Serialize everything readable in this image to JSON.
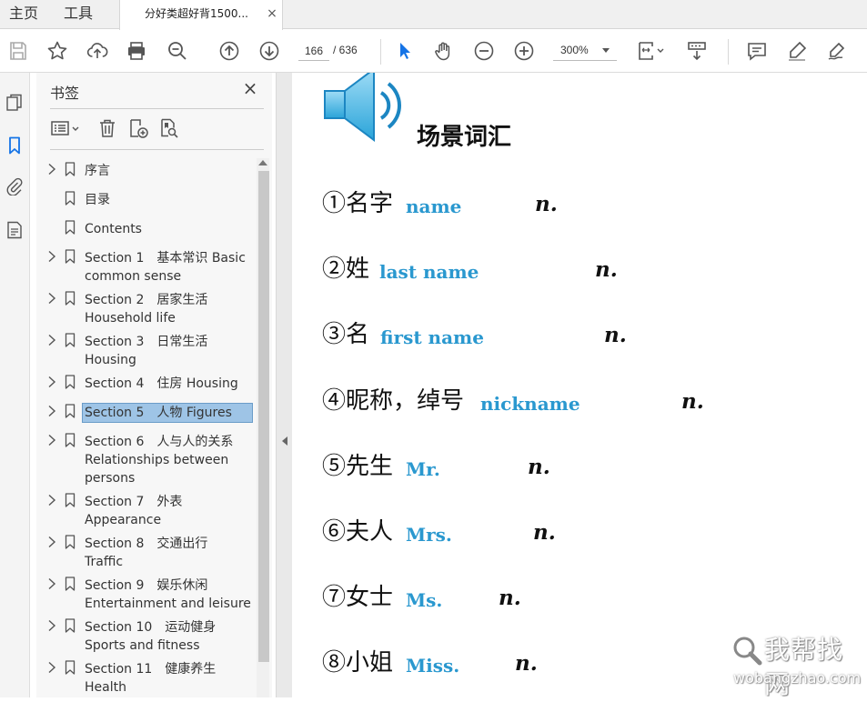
{
  "tabs": {
    "home": "主页",
    "tools": "工具",
    "document": "分好类超好背1500...",
    "close_symbol": "×"
  },
  "toolbar": {
    "page_current": "166",
    "page_total": "/ 636",
    "zoom": "300%",
    "icons": [
      "save-icon",
      "star-icon",
      "upload-icon",
      "print-icon",
      "zoom-search-icon",
      "page-up-icon",
      "page-down-icon",
      "select-cursor-icon",
      "hand-icon",
      "zoom-out-icon",
      "zoom-in-icon",
      "fit-page-icon",
      "scroll-mode-icon",
      "comment-icon",
      "highlight-icon",
      "sign-icon"
    ]
  },
  "rail": {
    "icons": [
      "page-thumbnails-icon",
      "bookmarks-icon",
      "attachments-icon",
      "document-properties-icon"
    ],
    "active": "bookmarks-icon"
  },
  "bookmarks_panel": {
    "title": "书签",
    "close_symbol": "×",
    "tools": [
      "options-menu-icon",
      "delete-bookmark-icon",
      "new-bookmark-icon",
      "bookmark-search-icon"
    ],
    "items": [
      {
        "label": "序言",
        "expandable": true
      },
      {
        "label": "目录",
        "expandable": false
      },
      {
        "label": "Contents",
        "expandable": false
      },
      {
        "label": "Section 1　基本常识 Basic\ncommon sense",
        "expandable": true
      },
      {
        "label": "Section 2　居家生活\nHousehold life",
        "expandable": true
      },
      {
        "label": "Section 3　日常生活\nHousing",
        "expandable": true
      },
      {
        "label": "Section 4　住房 Housing",
        "expandable": true
      },
      {
        "label": "Section 5　人物 Figures",
        "expandable": true,
        "selected": true
      },
      {
        "label": "Section 6　人与人的关系\nRelationships between\npersons",
        "expandable": true
      },
      {
        "label": "Section 7　外表\nAppearance",
        "expandable": true
      },
      {
        "label": "Section 8　交通出行\nTraffic",
        "expandable": true
      },
      {
        "label": "Section 9　娱乐休闲\nEntertainment and leisure",
        "expandable": true
      },
      {
        "label": "Section 10　运动健身\nSports and fitness",
        "expandable": true
      },
      {
        "label": "Section 11　健康养生\nHealth",
        "expandable": true
      }
    ]
  },
  "document": {
    "heading": "场景词汇",
    "entries": [
      {
        "zh": "①名字",
        "en": "name",
        "pos": "n."
      },
      {
        "zh": "②姓",
        "en": "last name",
        "pos": "n."
      },
      {
        "zh": "③名",
        "en": "first name",
        "pos": "n."
      },
      {
        "zh": "④昵称，绰号",
        "en": "nickname",
        "pos": "n."
      },
      {
        "zh": "⑤先生",
        "en": "Mr.",
        "pos": "n."
      },
      {
        "zh": "⑥夫人",
        "en": "Mrs.",
        "pos": "n."
      },
      {
        "zh": "⑦女士",
        "en": "Ms.",
        "pos": "n."
      },
      {
        "zh": "⑧小姐",
        "en": "Miss.",
        "pos": "n."
      }
    ]
  },
  "watermark": {
    "cn": "我帮找网",
    "url": "wobangzhao.com"
  },
  "colors": {
    "accent_blue": "#2a98cf",
    "selection": "#9ec4e6",
    "toolbar_icon": "#555555",
    "active_icon": "#1473e6"
  }
}
